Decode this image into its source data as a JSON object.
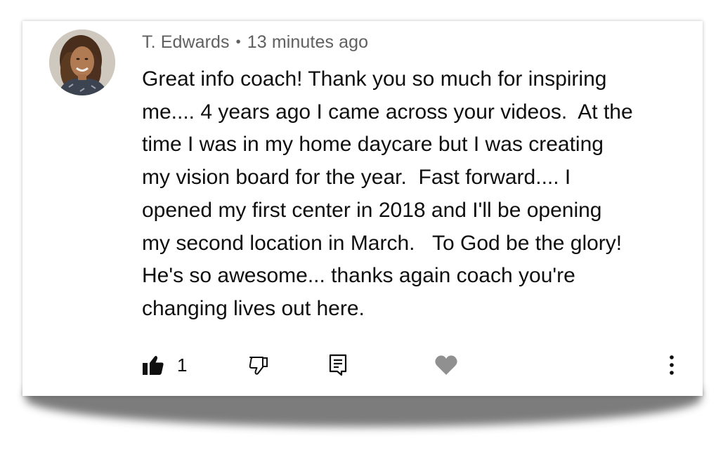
{
  "comment": {
    "author": "T. Edwards",
    "separator": "•",
    "timestamp": "13 minutes ago",
    "text_lines": [
      "Great info coach! Thank you so much for inspiring",
      "me.... 4 years ago I came across your videos.  At the",
      "time I was in my home daycare but I was creating",
      "my vision board for the year.  Fast forward.... I",
      "opened my first center in 2018 and I'll be opening",
      "my second location in March.   To God be the glory!",
      "He's so awesome... thanks again coach you're",
      "changing lives out here."
    ],
    "like_count": "1"
  },
  "icons": {
    "like": "thumb-up-filled-icon",
    "dislike": "thumb-down-outline-icon",
    "reply": "reply-comment-icon",
    "heart": "heart-icon",
    "more": "more-vertical-icon"
  },
  "colors": {
    "meta_text": "#606060",
    "body_text": "#0f0f0f",
    "heart_gray": "#909090",
    "icon_dark": "#0f0f0f"
  }
}
